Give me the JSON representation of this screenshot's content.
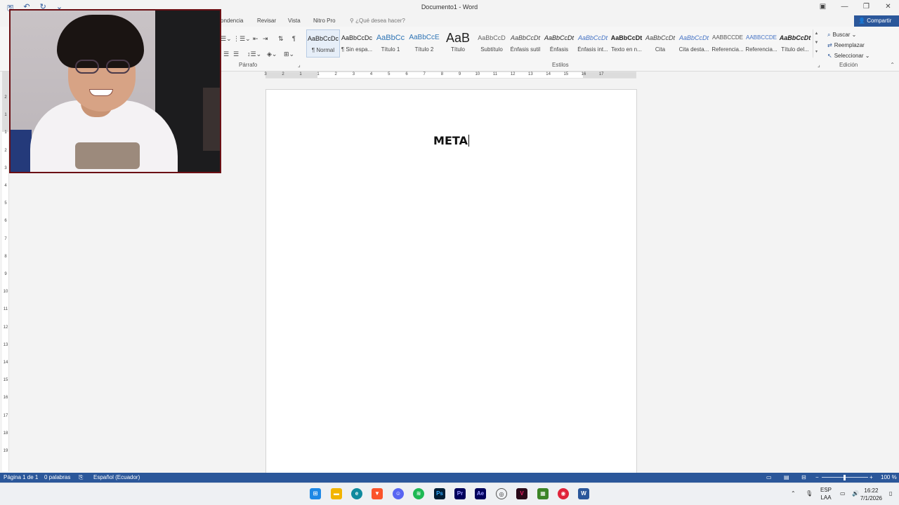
{
  "window": {
    "title": "Documento1 - Word",
    "minimize": "—",
    "restore": "❐",
    "close": "✕",
    "ribbon_display": "▣"
  },
  "qat": {
    "save": "🖫",
    "undo": "↶",
    "redo": "↻",
    "more": "⌄"
  },
  "ribbon_tabs": [
    {
      "label": "ondencia"
    },
    {
      "label": "Revisar"
    },
    {
      "label": "Vista"
    },
    {
      "label": "Nitro Pro"
    }
  ],
  "tell_me": {
    "icon": "lightbulb-icon",
    "placeholder": "¿Qué desea hacer?"
  },
  "share": {
    "label": "Compartir"
  },
  "groups": {
    "paragraph": "Párrafo",
    "styles": "Estilos",
    "editing": "Edición"
  },
  "styles": [
    {
      "sample": "AaBbCcDc",
      "name": "¶ Normal",
      "selected": true
    },
    {
      "sample": "AaBbCcDc",
      "name": "¶ Sin espa..."
    },
    {
      "sample": "AaBbCc",
      "name": "Título 1"
    },
    {
      "sample": "AaBbCcE",
      "name": "Título 2"
    },
    {
      "sample": "AaB",
      "name": "Título"
    },
    {
      "sample": "AaBbCcD",
      "name": "Subtítulo"
    },
    {
      "sample": "AaBbCcDt",
      "name": "Énfasis sutil"
    },
    {
      "sample": "AaBbCcDt",
      "name": "Énfasis"
    },
    {
      "sample": "AaBbCcDt",
      "name": "Énfasis int..."
    },
    {
      "sample": "AaBbCcDt",
      "name": "Texto en n..."
    },
    {
      "sample": "AaBbCcDt",
      "name": "Cita"
    },
    {
      "sample": "AaBbCcDt",
      "name": "Cita desta..."
    },
    {
      "sample": "AABBCCDE",
      "name": "Referencia..."
    },
    {
      "sample": "AABBCCDE",
      "name": "Referencia..."
    },
    {
      "sample": "AaBbCcDt",
      "name": "Título del..."
    }
  ],
  "editing": {
    "find": "Buscar",
    "replace": "Reemplazar",
    "select": "Seleccionar"
  },
  "hruler_numbers": [
    "3",
    "2",
    "1",
    "1",
    "2",
    "3",
    "4",
    "5",
    "6",
    "7",
    "8",
    "9",
    "10",
    "11",
    "12",
    "13",
    "14",
    "15",
    "16",
    "17"
  ],
  "vruler_numbers": [
    "2",
    "1",
    "1",
    "2",
    "3",
    "4",
    "5",
    "6",
    "7",
    "8",
    "9",
    "10",
    "11",
    "12",
    "13",
    "14",
    "15",
    "16",
    "17",
    "18",
    "19"
  ],
  "document": {
    "text": "META"
  },
  "status": {
    "page": "Página 1 de 1",
    "words": "0 palabras",
    "language": "Español (Ecuador)",
    "zoom": "100 %",
    "zoom_level": 1.0
  },
  "taskbar": {
    "apps": [
      "windows-start",
      "file-explorer",
      "edge",
      "brave",
      "discord",
      "spotify",
      "photoshop",
      "premiere",
      "after-effects",
      "chrome",
      "vegas",
      "minecraft",
      "obs",
      "word"
    ],
    "lang_top": "ESP",
    "lang_bottom": "LAA",
    "time": "16:22",
    "date": "7/1/2026"
  },
  "colors": {
    "accent": "#2b579a",
    "webcam_border": "#6b0f14"
  }
}
